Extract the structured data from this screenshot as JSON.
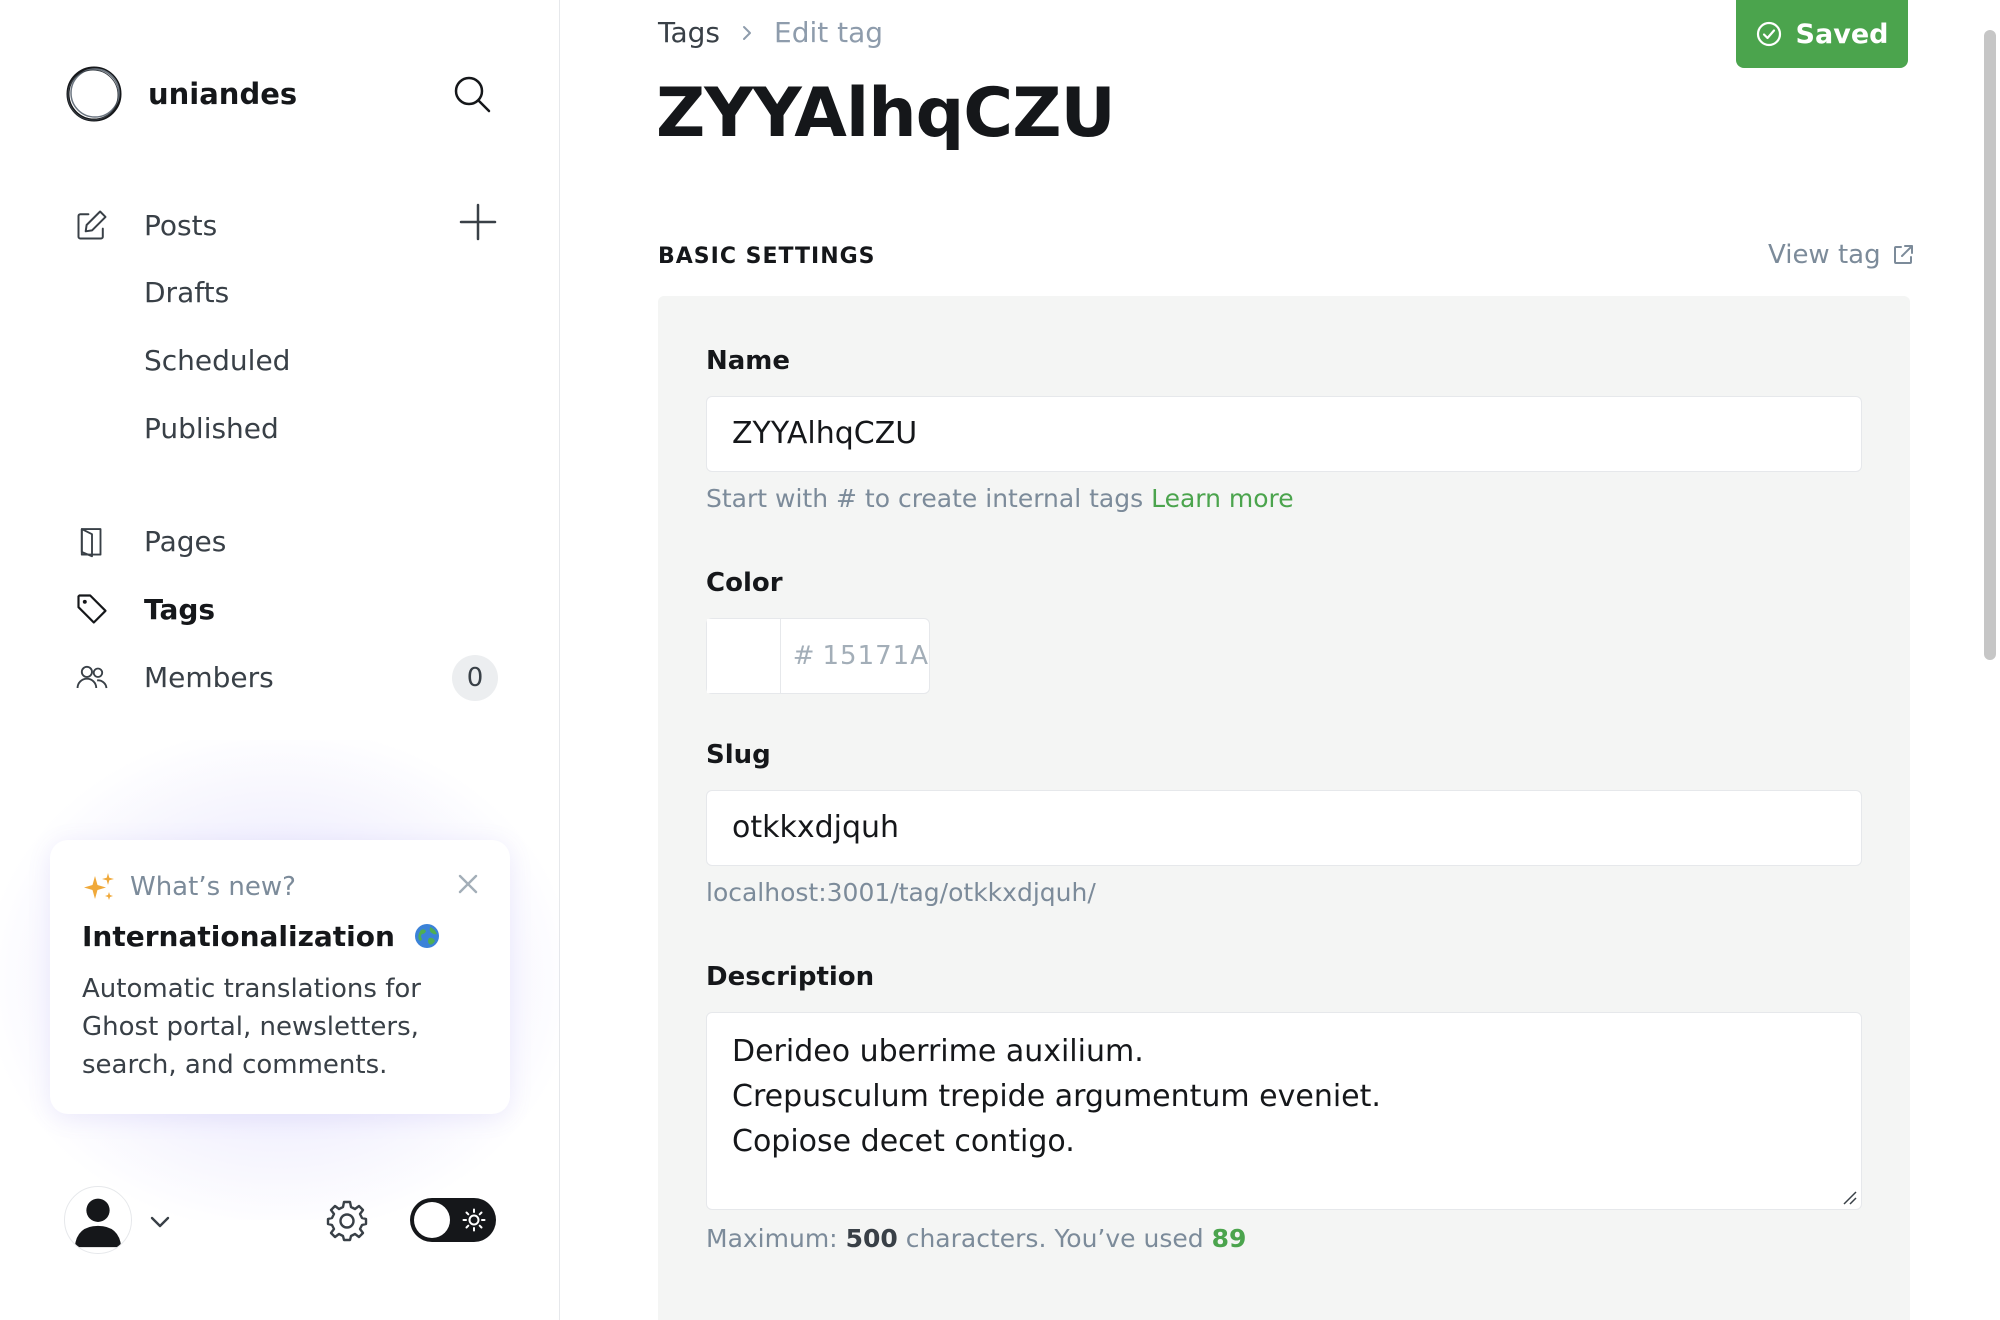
{
  "sidebar": {
    "brand_name": "uniandes",
    "nav": {
      "posts": "Posts",
      "drafts": "Drafts",
      "scheduled": "Scheduled",
      "published": "Published",
      "pages": "Pages",
      "tags": "Tags",
      "members": "Members",
      "members_count": "0"
    },
    "whats_new": {
      "kicker": "What’s new?",
      "title": "Internationalization",
      "body": "Automatic translations for Ghost portal, newsletters, search, and comments."
    }
  },
  "main": {
    "breadcrumb_root": "Tags",
    "breadcrumb_current": "Edit tag",
    "title": "ZYYAlhqCZU",
    "saved_label": "Saved",
    "section_title": "BASIC SETTINGS",
    "view_tag": "View tag",
    "name": {
      "label": "Name",
      "value": "ZYYAlhqCZU",
      "hint": "Start with # to create internal tags",
      "hint_link": "Learn more"
    },
    "color": {
      "label": "Color",
      "hash": "#",
      "value": "15171A"
    },
    "slug": {
      "label": "Slug",
      "value": "otkkxdjquh",
      "url": "localhost:3001/tag/otkkxdjquh/"
    },
    "description": {
      "label": "Description",
      "lines": [
        "Derideo uberrime auxilium.",
        "Crepusculum trepide argumentum eveniet.",
        "Copiose decet contigo."
      ],
      "count_prefix": "Maximum:",
      "max": "500",
      "count_mid": "characters. You’ve used",
      "used": "89"
    }
  },
  "colors": {
    "accent_green": "#4ba44d",
    "text_dark": "#15171a",
    "muted": "#7c8b9a",
    "panel_bg": "#f4f5f4"
  },
  "icons": [
    "brand-logo-icon",
    "search-icon",
    "edit-icon",
    "plus-icon",
    "pages-icon",
    "tag-icon",
    "members-icon",
    "sparkle-icon",
    "close-icon",
    "globe-icon",
    "avatar-icon",
    "chevron-down-icon",
    "gear-icon",
    "sun-icon",
    "chevron-right-icon",
    "check-circle-icon",
    "external-link-icon"
  ]
}
